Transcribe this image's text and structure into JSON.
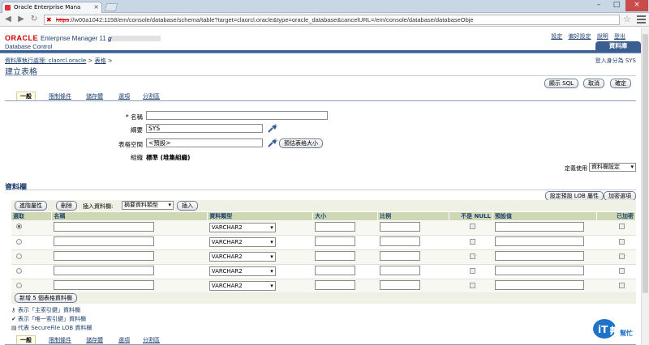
{
  "browser": {
    "tab_title": "Oracle Enterprise Mana",
    "url_prefix": "https",
    "url_rest": "://w00a1042:1158/em/console/database/schema/table?target=claorcl.oracle&type=oracle_database&cancelURL=/em/console/database/databaseObje"
  },
  "header": {
    "oracle": "ORACLE",
    "em": "Enterprise Manager 11",
    "em_g": "g",
    "dc": "Database Control",
    "links": [
      "設定",
      "偏好設定",
      "說明",
      "登出"
    ],
    "db_tab": "資料庫"
  },
  "breadcrumb": {
    "item1": "資料庫執行處理: claorcl.oracle",
    "sep": ">",
    "item2": "表格",
    "sep2": ">"
  },
  "logged_in": "登入身分為 SYS",
  "page_title": "建立表格",
  "actions": {
    "show_sql": "顯示 SQL",
    "cancel": "取消",
    "ok": "確定"
  },
  "tabs": [
    "一般",
    "限制條件",
    "儲存體",
    "選項",
    "分割區"
  ],
  "form": {
    "name_label": "* 名稱",
    "name_value": "",
    "schema_label": "綱要",
    "schema_value": "SYS",
    "tablespace_label": "表格空間",
    "tablespace_value": "<預設>",
    "estimate_btn": "預估表格大小",
    "org_label": "組織",
    "org_value": "標準 (堆集組織)"
  },
  "define_using_label": "定義使用",
  "define_using_value": "資料欄設定",
  "columns_section": "資料欄",
  "right_buttons": {
    "lob": "設定預設 LOB 屬性",
    "encrypt": "加密選項"
  },
  "toolbar": {
    "advanced": "進階屬性",
    "delete": "刪除",
    "insert_label": "插入資料欄:",
    "insert_type": "摘要資料類型",
    "insert_btn": "插入"
  },
  "grid": {
    "headers": [
      "選取",
      "名稱",
      "資料類型",
      "大小",
      "比例",
      "不是 NULL",
      "預設值",
      "已加密"
    ],
    "rows": [
      {
        "type": "VARCHAR2",
        "selected": true
      },
      {
        "type": "VARCHAR2",
        "selected": false
      },
      {
        "type": "VARCHAR2",
        "selected": false
      },
      {
        "type": "VARCHAR2",
        "selected": false
      },
      {
        "type": "VARCHAR2",
        "selected": false
      }
    ]
  },
  "add_rows_btn": "新增 5 個表格資料欄",
  "legend": [
    "表示「主索引鍵」資料欄",
    "表示「唯一索引鍵」資料欄",
    "代表 SecureFile LOB 資料欄"
  ],
  "watermark": {
    "it": "iT",
    "bang": "邦",
    "help": "幫忙"
  }
}
